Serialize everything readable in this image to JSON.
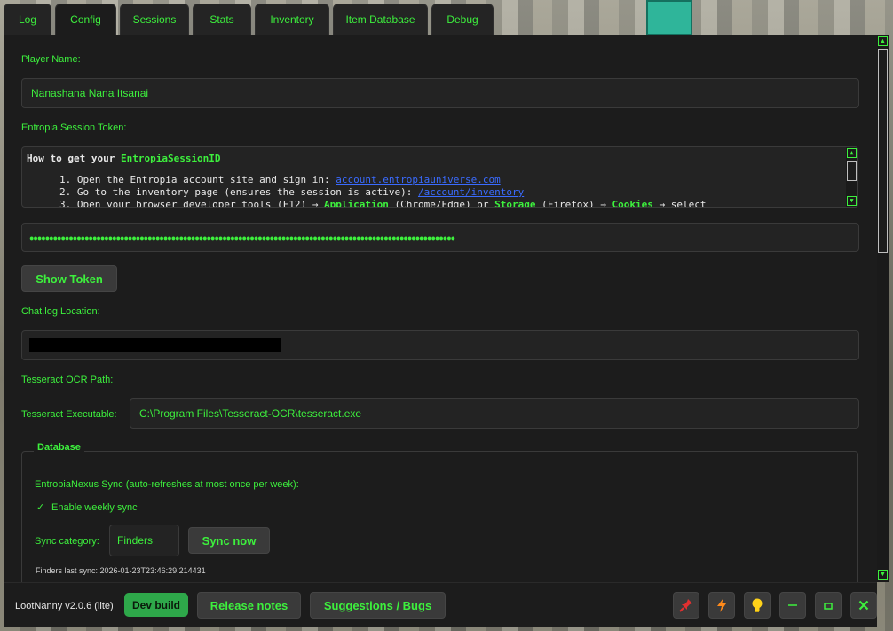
{
  "tabs": [
    "Log",
    "Config",
    "Sessions",
    "Stats",
    "Inventory",
    "Item Database",
    "Debug"
  ],
  "active_tab": "Config",
  "config": {
    "player_name_label": "Player Name:",
    "player_name_value": "Nanashana Nana Itsanai",
    "session_token_label": "Entropia Session Token:",
    "help": {
      "title_prefix": "How to get your ",
      "title_token": "EntropiaSessionID",
      "step1_text": "1. Open the Entropia account site and sign in: ",
      "step1_link": "account.entropiauniverse.com",
      "step2_text": "2. Go to the inventory page (ensures the session is active): ",
      "step2_link": "/account/inventory",
      "step3_a": "3. Open your browser developer tools (F12) → ",
      "step3_b": "Application",
      "step3_c": " (Chrome/Edge) or ",
      "step3_d": "Storage",
      "step3_e": " (Firefox) → ",
      "step3_f": "Cookies",
      "step3_g": " → select"
    },
    "token_masked": "●●●●●●●●●●●●●●●●●●●●●●●●●●●●●●●●●●●●●●●●●●●●●●●●●●●●●●●●●●●●●●●●●●●●●●●●●●●●●●●●●●●●●●●●●●●●●●●●●●●●●●●●●●●●",
    "show_token_button": "Show Token",
    "chatlog_label": "Chat.log Location:",
    "tesseract_ocr_label": "Tesseract OCR Path:",
    "tesseract_exe_label": "Tesseract Executable:",
    "tesseract_exe_value": "C:\\Program Files\\Tesseract-OCR\\tesseract.exe"
  },
  "database": {
    "group_title": "Database",
    "nexus_sync_label": "EntropiaNexus Sync (auto-refreshes at most once per week):",
    "weekly_sync_check": "✓",
    "weekly_sync_label": "Enable weekly sync",
    "sync_category_label": "Sync category:",
    "sync_category_value": "Finders",
    "sync_now_button": "Sync now",
    "last_sync_text": "Finders last sync: 2026-01-23T23:46:29.214431"
  },
  "footer": {
    "version": "LootNanny v2.0.6 (lite)",
    "dev_badge": "Dev build",
    "release_notes_button": "Release notes",
    "suggestions_button": "Suggestions / Bugs"
  },
  "icons": {
    "pin": "pin-icon",
    "bolt": "lightning-icon",
    "bulb": "lightbulb-icon",
    "minimize": "minimize-icon",
    "maximize": "maximize-icon",
    "close": "close-icon"
  },
  "colors": {
    "accent_green": "#3df03d",
    "panel_bg": "#1c1c1c",
    "dev_badge": "#2ea84a",
    "link_blue": "#3a6bff",
    "pin_red": "#e03030",
    "bolt_orange": "#ff8a1a",
    "bulb_yellow": "#ffd21a"
  }
}
